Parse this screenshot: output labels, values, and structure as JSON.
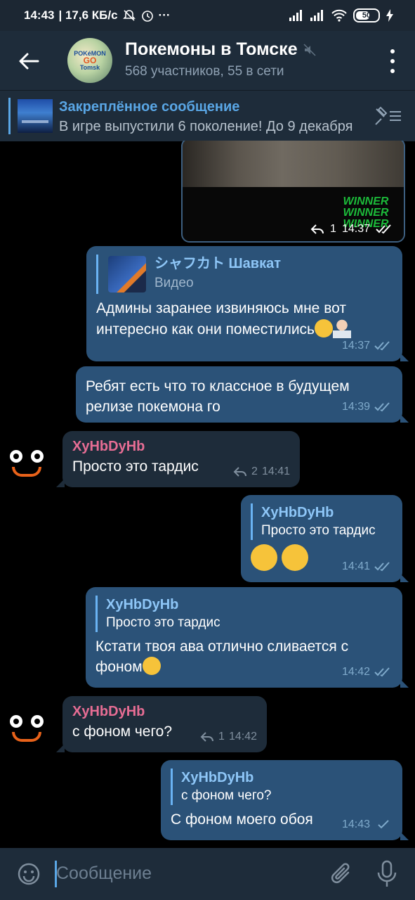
{
  "status_bar": {
    "time": "14:43",
    "net_speed": "| 17,6 КБ/с",
    "battery": "50"
  },
  "header": {
    "avatar_text_top": "POKéMON",
    "avatar_text_go": "GO",
    "avatar_text_city": "Tomsk",
    "title": "Покемоны в Томске",
    "subtitle": "568 участников, 55 в сети"
  },
  "pinned": {
    "title": "Закреплённое сообщение",
    "text": "В игре выпустили 6 поколение!  До 9 декабря"
  },
  "messages": {
    "video": {
      "winner_lines": [
        "WINNER",
        "WINNER",
        "WINNER"
      ],
      "reply_count": "1",
      "time": "14:37"
    },
    "m1": {
      "reply_name": "シャフカト Шавкат",
      "reply_text": "Видео",
      "text": "Админы заранее извиняюсь мне вот интересно как они поместились",
      "time": "14:37"
    },
    "m2": {
      "text": "Ребят есть что то классное в будущем релизе покемона го",
      "time": "14:39"
    },
    "m3": {
      "sender": "XyHbDyHb",
      "text": "Просто это тардис",
      "reply_count": "2",
      "time": "14:41"
    },
    "m4": {
      "reply_name": "XyHbDyHb",
      "reply_text": "Просто это тардис",
      "time": "14:41"
    },
    "m5": {
      "reply_name": "XyHbDyHb",
      "reply_text": "Просто это тардис",
      "text": "Кстати твоя ава отлично сливается с фоном",
      "time": "14:42"
    },
    "m6": {
      "sender": "XyHbDyHb",
      "text": "с фоном чего?",
      "reply_count": "1",
      "time": "14:42"
    },
    "m7": {
      "reply_name": "XyHbDyHb",
      "reply_text": "с фоном чего?",
      "text": "С фоном моего обоя",
      "time": "14:43"
    }
  },
  "input": {
    "placeholder": "Сообщение"
  },
  "colors": {
    "accent": "#5aa7e6",
    "outgoing_bubble": "#2b5278",
    "incoming_bubble": "#1e2c3a",
    "sender_name": "#e76d94"
  }
}
